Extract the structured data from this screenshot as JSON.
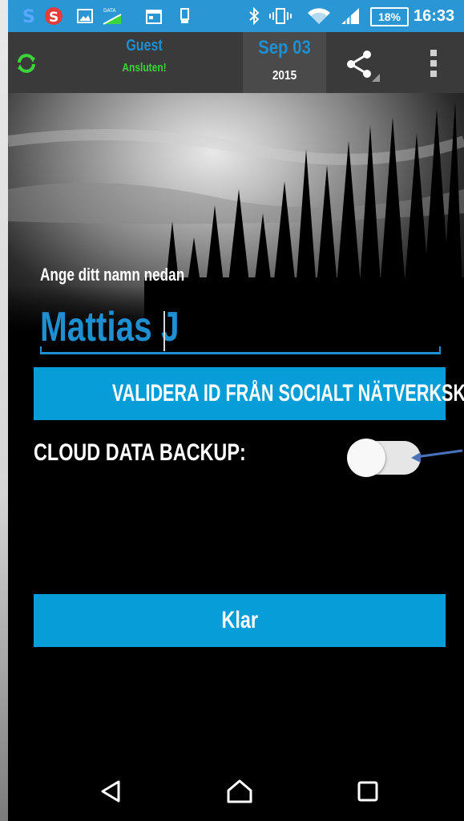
{
  "status_bar": {
    "battery": "18%",
    "time": "16:33",
    "data_badge": "DATA"
  },
  "action_bar": {
    "user_name": "Guest",
    "user_status": "Ansluten!",
    "date": "Sep 03",
    "year": "2015"
  },
  "form": {
    "name_prompt": "Ange ditt namn nedan",
    "name_value": "Mattias J",
    "validate_label": "VALIDERA ID FRÅN SOCIALT NÄTVERKSKONTO",
    "backup_label": "CLOUD DATA BACKUP:",
    "backup_enabled": false,
    "done_label": "Klar"
  },
  "colors": {
    "accent": "#069dd9",
    "status_bar": "#2b96d4",
    "connected": "#3bd43b",
    "annotation_arrow": "#4a72b8"
  },
  "icons": [
    "sync-icon",
    "share-icon",
    "overflow-menu-icon",
    "back-icon",
    "home-icon",
    "recents-icon"
  ]
}
